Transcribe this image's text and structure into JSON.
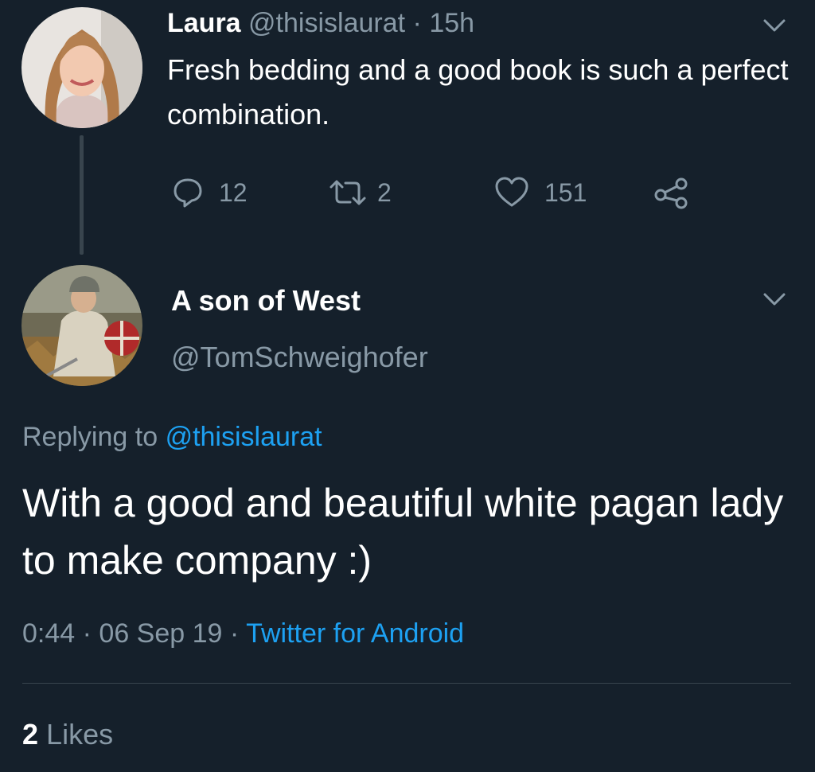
{
  "parent_tweet": {
    "author_name": "Laura",
    "author_handle": "@thisislaurat",
    "separator": "·",
    "time_ago": "15h",
    "text": "Fresh bedding and a good book is such a perfect combination.",
    "actions": {
      "reply_count": "12",
      "retweet_count": "2",
      "like_count": "151"
    }
  },
  "reply_tweet": {
    "author_name": "A son of West",
    "author_handle": "@TomSchweighofer",
    "replying_prefix": "Replying to",
    "replying_handle": "@thisislaurat",
    "text": "With a good and beautiful white pagan lady to make company :)",
    "time": "0:44",
    "date": "06 Sep 19",
    "separator": "·",
    "source": "Twitter for Android",
    "likes_count": "2",
    "likes_label": "Likes"
  },
  "icons": {
    "reply": "speech-bubble-icon",
    "retweet": "retweet-icon",
    "like": "heart-icon",
    "share": "share-icon",
    "menu": "chevron-down-icon"
  },
  "colors": {
    "background": "#15202b",
    "text": "#ffffff",
    "muted": "#8899a6",
    "link": "#1da1f2",
    "divider": "#38444d"
  }
}
